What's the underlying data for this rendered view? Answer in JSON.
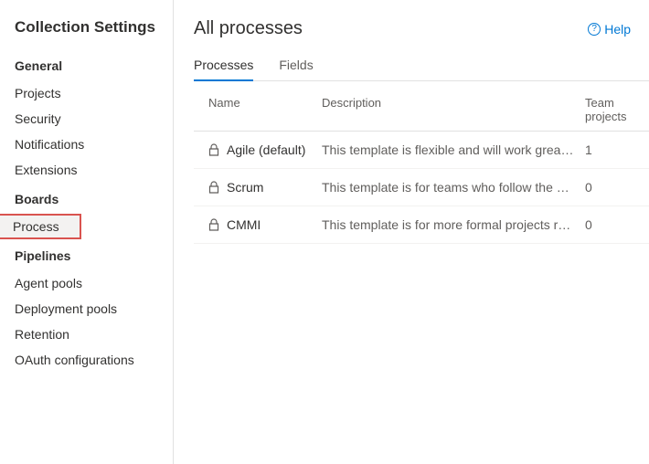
{
  "sidebar": {
    "title": "Collection Settings",
    "sections": [
      {
        "label": "General",
        "items": [
          {
            "label": "Projects"
          },
          {
            "label": "Security"
          },
          {
            "label": "Notifications"
          },
          {
            "label": "Extensions"
          }
        ]
      },
      {
        "label": "Boards",
        "items": [
          {
            "label": "Process",
            "selected": true
          }
        ]
      },
      {
        "label": "Pipelines",
        "items": [
          {
            "label": "Agent pools"
          },
          {
            "label": "Deployment pools"
          },
          {
            "label": "Retention"
          },
          {
            "label": "OAuth configurations"
          }
        ]
      }
    ]
  },
  "main": {
    "title": "All processes",
    "help_label": "Help",
    "tabs": [
      {
        "label": "Processes",
        "active": true
      },
      {
        "label": "Fields"
      }
    ],
    "columns": {
      "name": "Name",
      "description": "Description",
      "team_projects": "Team projects"
    },
    "rows": [
      {
        "name": "Agile (default)",
        "description": "This template is flexible and will work great for ...",
        "count": "1"
      },
      {
        "name": "Scrum",
        "description": "This template is for teams who follow the Scru...",
        "count": "0"
      },
      {
        "name": "CMMI",
        "description": "This template is for more formal projects requi...",
        "count": "0"
      }
    ]
  }
}
